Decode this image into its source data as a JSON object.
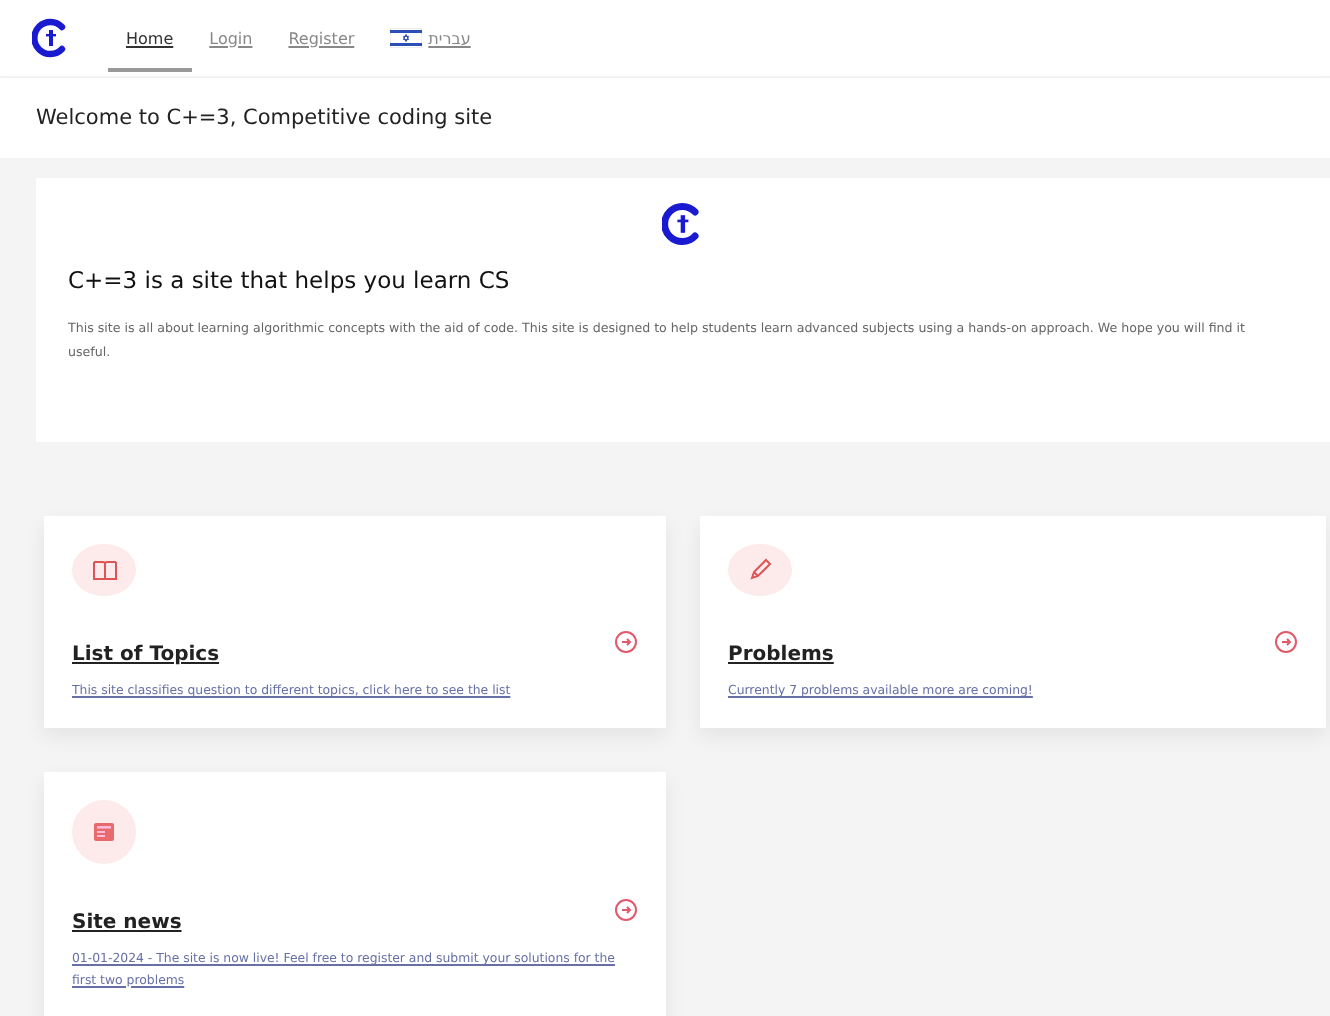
{
  "nav": {
    "items": [
      {
        "label": "Home",
        "selected": true,
        "kind": "link"
      },
      {
        "label": "Login",
        "selected": false,
        "kind": "link"
      },
      {
        "label": "Register",
        "selected": false,
        "kind": "link"
      },
      {
        "label": "עברית",
        "selected": false,
        "kind": "language"
      }
    ]
  },
  "welcome": "Welcome to C+=3, Competitive coding site",
  "intro": {
    "title": "C+=3 is a site that helps you learn CS",
    "text": "This site is all about learning algorithmic concepts with the aid of code. This site is designed to help students learn advanced subjects using a hands-on approach. We hope you will find it useful."
  },
  "cards": [
    {
      "kind": "book",
      "title": "List of Topics",
      "link": "This site classifies question to different topics, click here to see the list"
    },
    {
      "kind": "pencil",
      "title": "Problems",
      "link": "Currently 7 problems available more are coming!"
    },
    {
      "kind": "news",
      "title": "Site news",
      "link": "01-01-2024 - The site is now live! Feel free to register and submit your solutions for the first two problems"
    }
  ]
}
